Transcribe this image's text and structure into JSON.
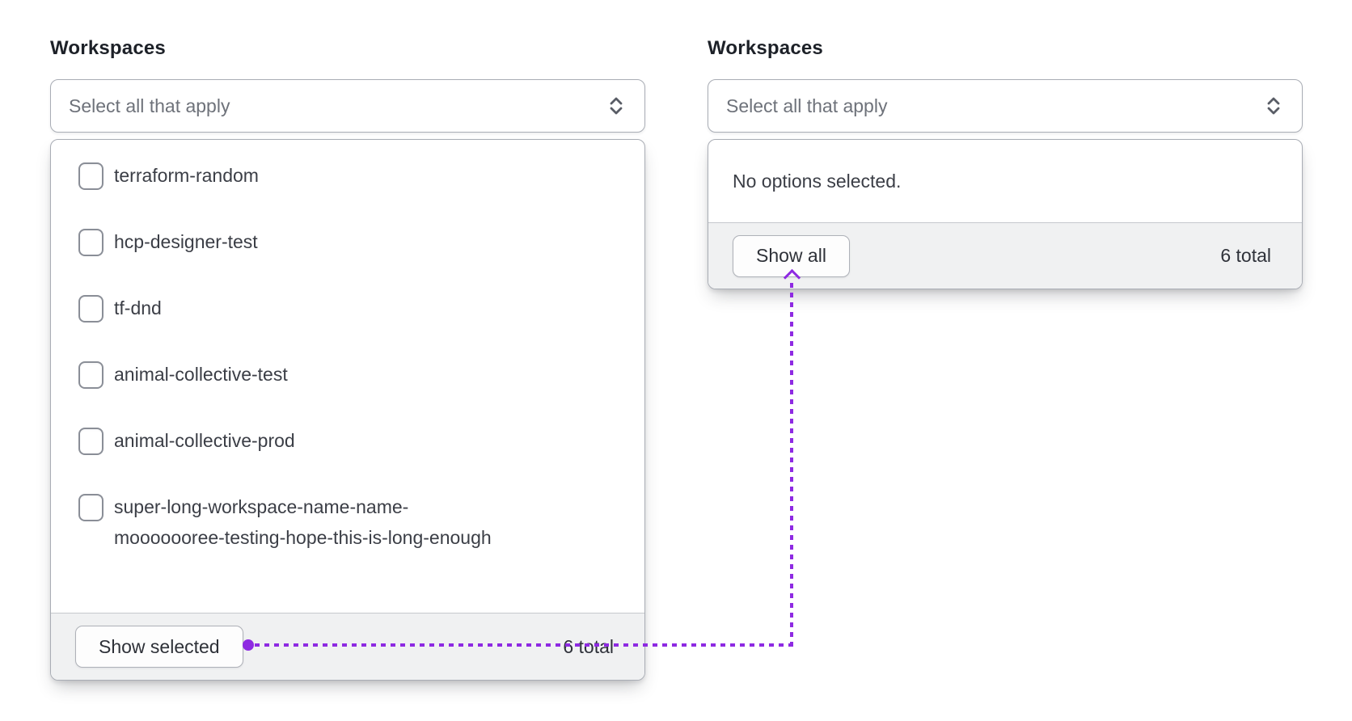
{
  "panels": [
    {
      "label": "Workspaces",
      "select_placeholder": "Select all that apply",
      "dropdown": {
        "options": [
          "terraform-random",
          "hcp-designer-test",
          "tf-dnd",
          "animal-collective-test",
          "animal-collective-prod",
          "super-long-workspace-name-name-\nmooooooree-testing-hope-this-is-long-enough"
        ],
        "footer": {
          "button_label": "Show selected",
          "total_label": "6 total"
        }
      }
    },
    {
      "label": "Workspaces",
      "select_placeholder": "Select all that apply",
      "dropdown": {
        "empty_message": "No options selected.",
        "footer": {
          "button_label": "Show all",
          "total_label": "6 total"
        }
      }
    }
  ],
  "annotation": {
    "color": "#8e2ae2",
    "from": "Show selected button",
    "to": "Show all button"
  }
}
